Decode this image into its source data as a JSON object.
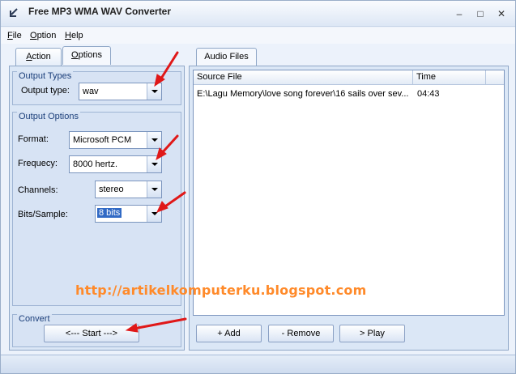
{
  "window": {
    "title": "Free MP3 WMA WAV Converter",
    "controls": {
      "minimize": "–",
      "maximize": "□",
      "close": "✕"
    }
  },
  "menu": {
    "file": {
      "accel": "F",
      "rest": "ile"
    },
    "option": {
      "accel": "O",
      "rest": "ption"
    },
    "help": {
      "accel": "H",
      "rest": "elp"
    }
  },
  "left_tabs": {
    "action": {
      "accel": "A",
      "rest": "ction"
    },
    "options": {
      "accel": "O",
      "rest": "ptions"
    }
  },
  "output_types": {
    "group_title": "Output Types",
    "output_type_label": "Output type:",
    "output_type_value": "wav"
  },
  "output_options": {
    "group_title": "Output Options",
    "format_label": "Format:",
    "format_value": "Microsoft PCM",
    "frequency_label": "Frequecy:",
    "frequency_value": "8000 hertz.",
    "channels_label": "Channels:",
    "channels_value": "stereo",
    "bits_label": "Bits/Sample:",
    "bits_value": "8 bits"
  },
  "convert": {
    "group_title": "Convert",
    "start_label": "<--- Start --->"
  },
  "audio_files": {
    "tab_label": "Audio Files",
    "tab_accel": "F",
    "columns": {
      "source": "Source File",
      "time": "Time"
    },
    "rows": [
      {
        "source": "E:\\Lagu Memory\\love song forever\\16 sails over sev...",
        "time": "04:43"
      }
    ],
    "add_label": "+ Add",
    "remove_label": "- Remove",
    "play_label": "> Play"
  },
  "watermark": "http://artikelkomputerku.blogspot.com",
  "colors": {
    "accent_arrow": "#e01818",
    "watermark": "#ff8a2a",
    "selection": "#316ac5"
  }
}
